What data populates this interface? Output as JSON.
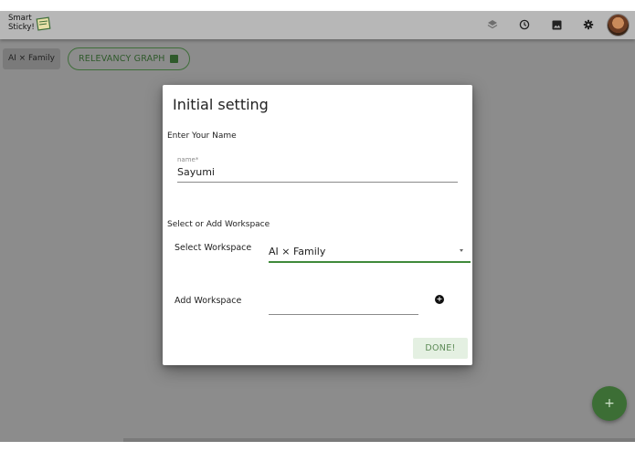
{
  "app": {
    "logo_line1": "Smart",
    "logo_line2": "Sticky!",
    "logo_icon": "sticky-note-icon"
  },
  "toolbar": {
    "icons": [
      "layers-icon",
      "clock-icon",
      "image-icon",
      "gear-icon",
      "avatar"
    ]
  },
  "chips": {
    "workspace_label": "AI × Family",
    "graph_label": "RELEVANCY GRAPH",
    "graph_icon": "chart-icon"
  },
  "dialog": {
    "title": "Initial setting",
    "name_section": "Enter Your Name",
    "name_field_label": "name*",
    "name_value": "Sayumi",
    "workspace_section": "Select or Add Workspace",
    "select_label": "Select Workspace",
    "select_value": "AI × Family",
    "add_label": "Add Workspace",
    "add_value": "",
    "done_label": "DONE!"
  },
  "fab": {
    "label": "+"
  },
  "colors": {
    "accent_green": "#3f8a3a",
    "fab_green": "#3c6e35",
    "backdrop": "#8c8c8c",
    "appbar": "#b7b7b7"
  }
}
